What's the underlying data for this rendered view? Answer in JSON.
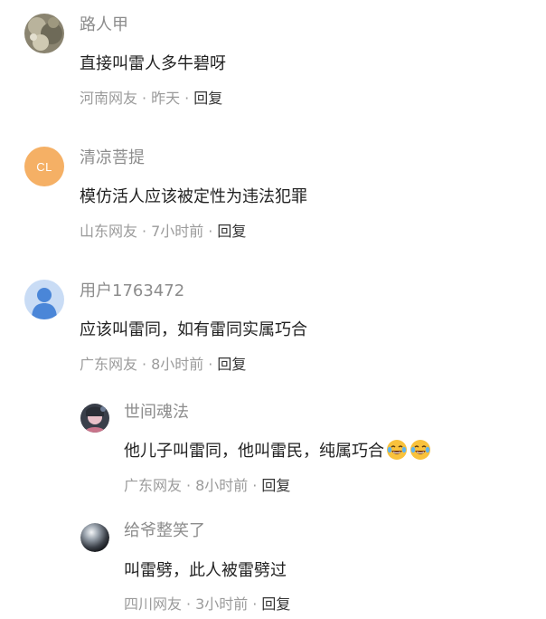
{
  "comments": [
    {
      "username": "路人甲",
      "text": "直接叫雷人多牛碧呀",
      "location": "河南网友",
      "time": "昨天",
      "reply_label": "回复",
      "avatar_icon": "photo-avatar"
    },
    {
      "username": "清凉菩提",
      "text": "模仿活人应该被定性为违法犯罪",
      "location": "山东网友",
      "time": "7小时前",
      "reply_label": "回复",
      "avatar_initials": "CL",
      "avatar_color": "#f5b065"
    },
    {
      "username": "用户1763472",
      "text": "应该叫雷同，如有雷同实属巧合",
      "location": "广东网友",
      "time": "8小时前",
      "reply_label": "回复",
      "avatar_icon": "default-user-icon",
      "avatar_color": "#c9dcf5"
    }
  ],
  "replies": [
    {
      "username": "世间魂法",
      "text": "他儿子叫雷同，他叫雷民，纯属巧合",
      "emoji": "laughing-tears-emoji",
      "location": "广东网友",
      "time": "8小时前",
      "reply_label": "回复",
      "avatar_icon": "photo-avatar"
    },
    {
      "username": "给爷整笑了",
      "text": "叫雷劈，此人被雷劈过",
      "location": "四川网友",
      "time": "3小时前",
      "reply_label": "回复",
      "avatar_icon": "sphere-avatar"
    }
  ],
  "separator": "·"
}
